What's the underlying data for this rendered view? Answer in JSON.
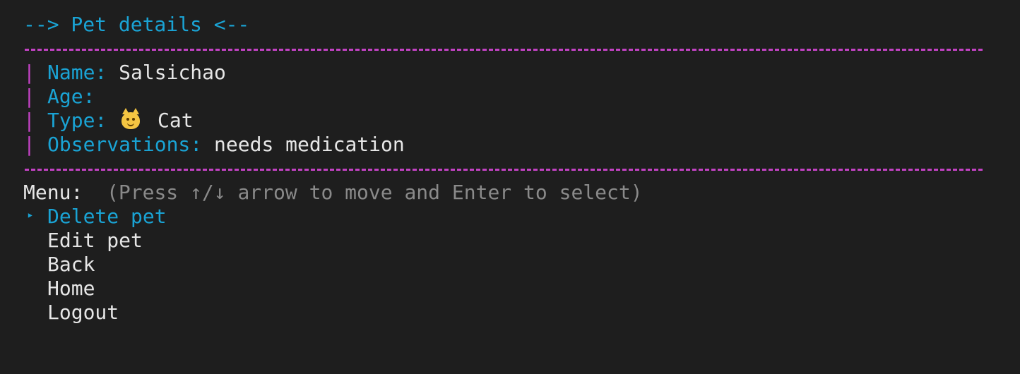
{
  "header": {
    "title": "--> Pet details <--"
  },
  "details": {
    "fields": [
      {
        "label": "Name:",
        "value": "Salsichao"
      },
      {
        "label": "Age:",
        "value": ""
      },
      {
        "label": "Type:",
        "value": "Cat",
        "icon": "cat-face-icon"
      },
      {
        "label": "Observations:",
        "value": "needs medication"
      }
    ]
  },
  "menu": {
    "label": "Menu:",
    "hint": "(Press ↑/↓ arrow to move and Enter to select)",
    "pointer": "‣",
    "items": [
      {
        "label": "Delete pet",
        "selected": true
      },
      {
        "label": "Edit pet",
        "selected": false
      },
      {
        "label": "Back",
        "selected": false
      },
      {
        "label": "Home",
        "selected": false
      },
      {
        "label": "Logout",
        "selected": false
      }
    ]
  },
  "colors": {
    "background": "#1e1e1e",
    "accent": "#1aa3d4",
    "rule": "#c342c4",
    "text": "#e6e6e6",
    "hint": "#8a8a8a"
  }
}
